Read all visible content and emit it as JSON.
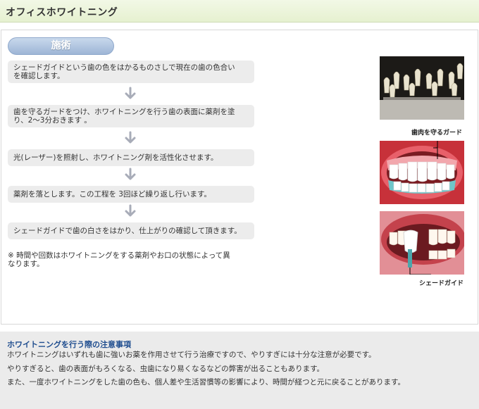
{
  "header": {
    "title": "オフィスホワイトニング"
  },
  "section": {
    "pill_label": "施術"
  },
  "steps": [
    {
      "line1": "シェードガイドという歯の色をはかるものさしで現在の歯の色合い",
      "line2": "を確認します。"
    },
    {
      "line1": "歯を守るガードをつけ、ホワイトニングを行う歯の表面に薬剤を塗",
      "line2": "り、2～3分おきます 。"
    },
    {
      "line1": "光(レーザー)を照射し、ホワイトニング剤を活性化させます。"
    },
    {
      "line1": "薬剤を落とします。この工程を 3回ほど繰り返し行います。"
    },
    {
      "line1": "シェードガイドで歯の白さをはかり、仕上がりの確認して頂きます。"
    }
  ],
  "note": {
    "line1": "※ 時間や回数はホワイトニングをする薬剤やお口の状態によって異",
    "line2": "なります。"
  },
  "images": {
    "shade_guide_photo": "shade-guide-photo",
    "gum_guard_illustration": "gum-guard-illustration",
    "shade_check_illustration": "shade-check-illustration",
    "gum_guard_label": "歯肉を守るガード",
    "shade_guide_label": "シェードガイド"
  },
  "footer": {
    "title": "ホワイトニングを行う際の注意事項",
    "lines": [
      "ホワイトニングはいずれも歯に強いお薬を作用させて行う治療ですので、やりすぎには十分な注意が必要です。",
      "やりすぎると、歯の表面がもろくなる、虫歯になり易くなるなどの弊害が出ることもあります。",
      "また、一度ホワイトニングをした歯の色も、個人差や生活習慣等の影響により、時間が経つと元に戻ることがあります。"
    ]
  },
  "colors": {
    "header_bg": "#e6f1d0",
    "pill_blue": "#9db5d6",
    "step_bg": "#ececec",
    "arrow_gray": "#a8acb8",
    "footer_title": "#1f4d8f",
    "footer_bg": "#ebebeb"
  }
}
